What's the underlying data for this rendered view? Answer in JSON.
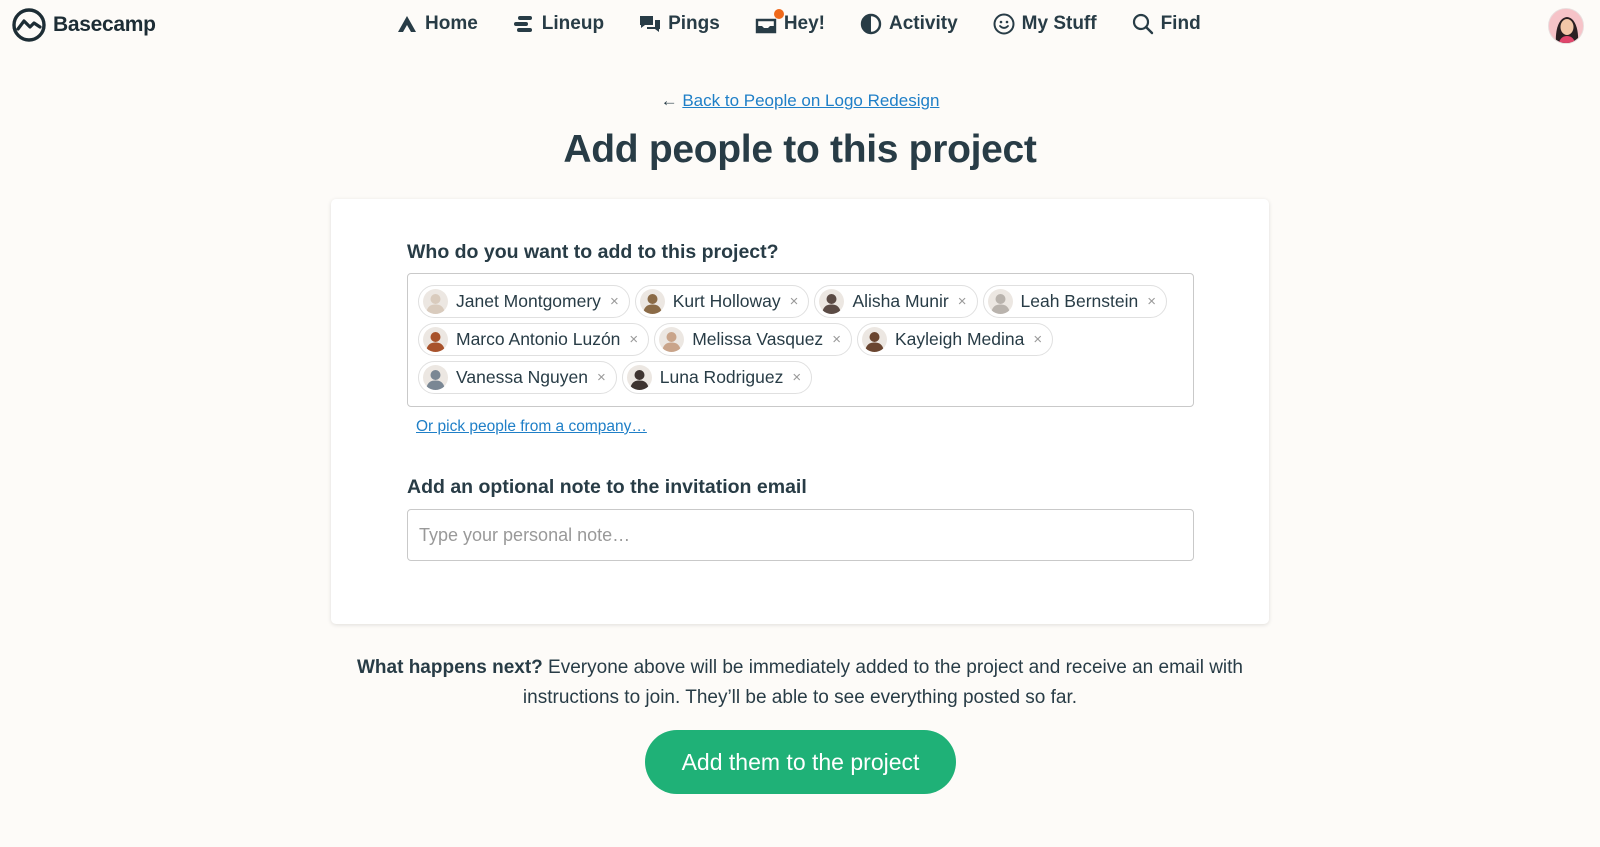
{
  "app": {
    "logo_text": "Basecamp",
    "accent_color": "#1fb177",
    "link_color": "#1f7fc7",
    "notification_color": "#f0691a"
  },
  "nav": {
    "items": [
      {
        "label": "Home",
        "icon": "home-icon"
      },
      {
        "label": "Lineup",
        "icon": "lineup-icon"
      },
      {
        "label": "Pings",
        "icon": "pings-icon"
      },
      {
        "label": "Hey!",
        "icon": "hey-icon"
      },
      {
        "label": "Activity",
        "icon": "activity-icon"
      },
      {
        "label": "My Stuff",
        "icon": "my-stuff-icon"
      },
      {
        "label": "Find",
        "icon": "search-icon"
      }
    ]
  },
  "header": {
    "back_arrow": "←",
    "back_link": "Back to People on Logo Redesign",
    "title": "Add people to this project"
  },
  "form": {
    "people_label": "Who do you want to add to this project?",
    "people": [
      {
        "name": "Janet Montgomery",
        "avatar_color": "#d9cbbd"
      },
      {
        "name": "Kurt Holloway",
        "avatar_color": "#8b6b47"
      },
      {
        "name": "Alisha Munir",
        "avatar_color": "#5b4b45"
      },
      {
        "name": "Leah Bernstein",
        "avatar_color": "#b9b3ad"
      },
      {
        "name": "Marco Antonio Luzón",
        "avatar_color": "#a8522b"
      },
      {
        "name": "Melissa Vasquez",
        "avatar_color": "#c9a48a"
      },
      {
        "name": "Kayleigh Medina",
        "avatar_color": "#6a4530"
      },
      {
        "name": "Vanessa Nguyen",
        "avatar_color": "#7a8794"
      },
      {
        "name": "Luna Rodriguez",
        "avatar_color": "#3e3430"
      }
    ],
    "remove_symbol": "×",
    "pick_company_link": "Or pick people from a company…",
    "note_label": "Add an optional note to the invitation email",
    "note_placeholder": "Type your personal note…",
    "note_value": ""
  },
  "footer": {
    "explain_bold": "What happens next?",
    "explain_text": " Everyone above will be immediately added to the project and receive an email with instructions to join. They’ll be able to see everything posted so far.",
    "submit_label": "Add them to the project"
  }
}
